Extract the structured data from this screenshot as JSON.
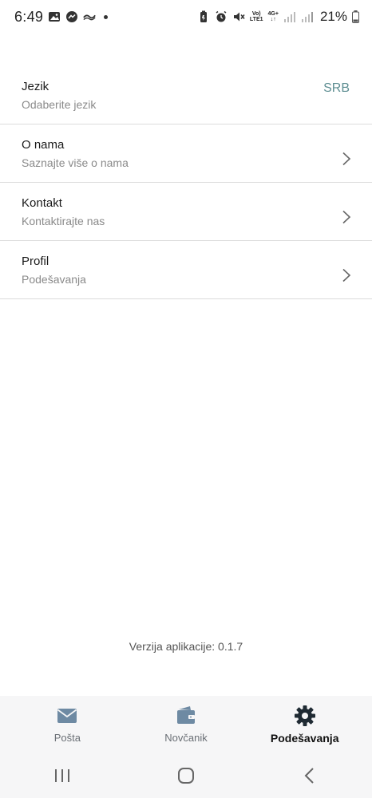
{
  "status_bar": {
    "time": "6:49",
    "network_volte": "Vo)",
    "network_lte": "LTE1",
    "network_4g": "4G+",
    "battery": "21%"
  },
  "settings": [
    {
      "title": "Jezik",
      "subtitle": "Odaberite jezik",
      "value": "SRB",
      "chevron": false
    },
    {
      "title": "O nama",
      "subtitle": "Saznajte više o nama",
      "chevron": true
    },
    {
      "title": "Kontakt",
      "subtitle": "Kontaktirajte nas",
      "chevron": true
    },
    {
      "title": "Profil",
      "subtitle": "Podešavanja",
      "chevron": true
    }
  ],
  "version_text": "Verzija aplikacije: 0.1.7",
  "tabs": [
    {
      "label": "Pošta",
      "icon": "mail-icon",
      "active": false
    },
    {
      "label": "Novčanik",
      "icon": "wallet-icon",
      "active": false
    },
    {
      "label": "Podešavanja",
      "icon": "gear-icon",
      "active": true
    }
  ],
  "colors": {
    "accent": "#5f8f93",
    "inactive_icon": "#6e8aa3",
    "active_icon": "#1f2a33",
    "divider": "#dcdcdc"
  }
}
